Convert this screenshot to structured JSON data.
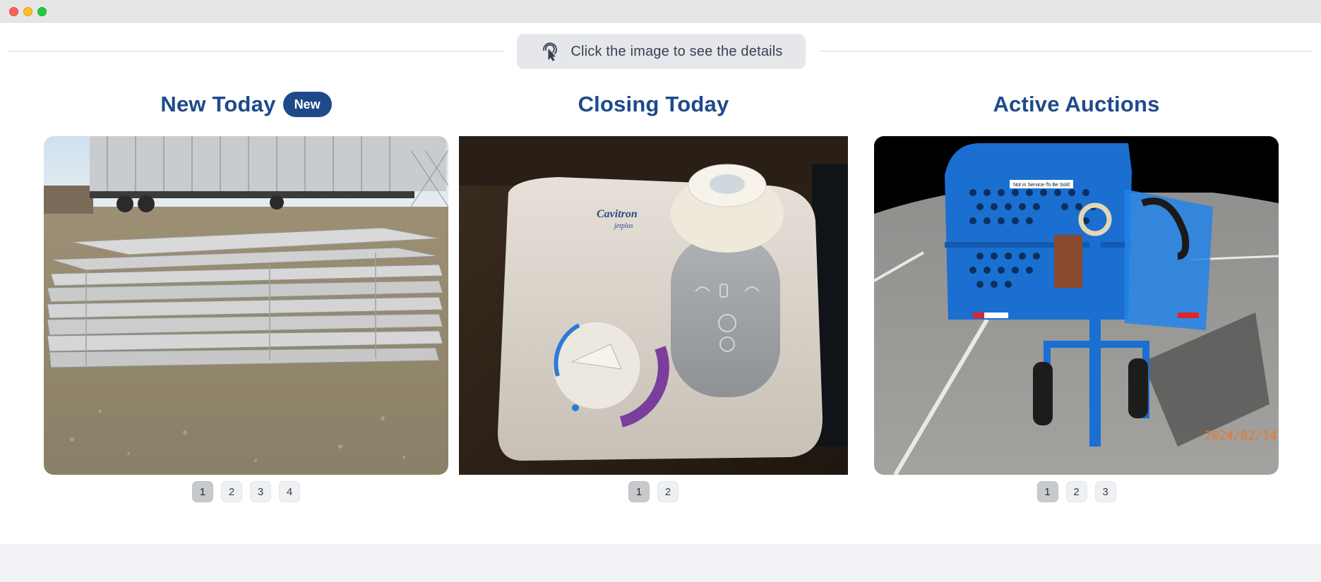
{
  "hint": {
    "text": "Click the image to see the details",
    "icon": "tap-pointer-icon"
  },
  "columns": [
    {
      "title": "New Today",
      "badge": "New",
      "photo": "stacked-metal-panels-photo",
      "pages": [
        "1",
        "2",
        "3",
        "4"
      ],
      "active_page": "1"
    },
    {
      "title": "Closing Today",
      "photo": "dental-scaler-device-photo",
      "brand_text": "Cavitron",
      "brand_sub": "jetplus",
      "pages": [
        "1",
        "2"
      ],
      "active_page": "1"
    },
    {
      "title": "Active Auctions",
      "photo": "blue-utility-cart-photo",
      "sign_text": "Not in Service-To Be Sold",
      "date_stamp": "2024/02/14",
      "pages": [
        "1",
        "2",
        "3"
      ],
      "active_page": "1"
    }
  ],
  "colors": {
    "title": "#1e4a8a",
    "badge_bg": "#1e4a8a",
    "hint_bg": "#e5e7eb",
    "footer_bg": "#f1f3f7"
  }
}
